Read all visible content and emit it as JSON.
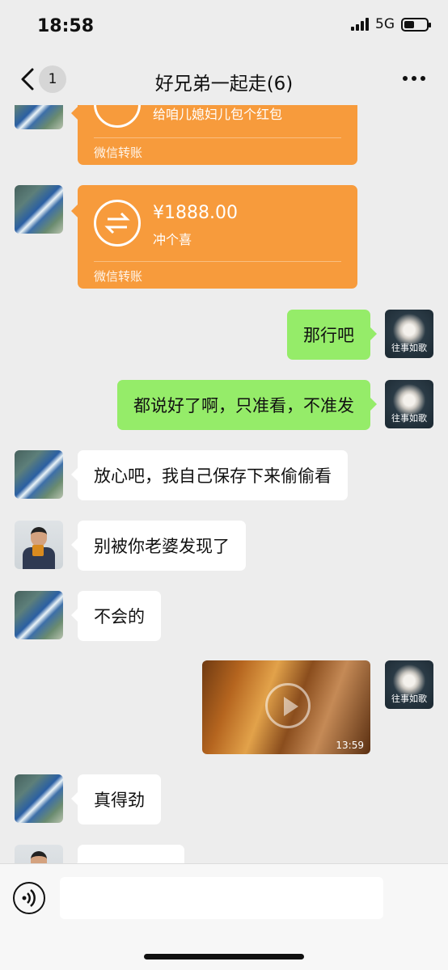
{
  "status_bar": {
    "time": "18:58",
    "network": "5G"
  },
  "header": {
    "unread_count": "1",
    "title": "好兄弟一起走(6)"
  },
  "messages": {
    "transfer_top": {
      "note": "给咱儿媳妇儿包个红包",
      "footer": "微信转账"
    },
    "transfer_main": {
      "amount": "¥1888.00",
      "note": "冲个喜",
      "footer": "微信转账"
    },
    "m1": "那行吧",
    "m2": "都说好了啊，只准看，不准发",
    "m3": "放心吧，我自己保存下来偷偷看",
    "m4": "别被你老婆发现了",
    "m5": "不会的",
    "video_duration": "13:59",
    "m6": "真得劲",
    "my_avatar_caption": "往事如歌"
  },
  "colors": {
    "accent_green": "#95ec69",
    "transfer_orange": "#f79b3c",
    "background": "#ededed"
  }
}
